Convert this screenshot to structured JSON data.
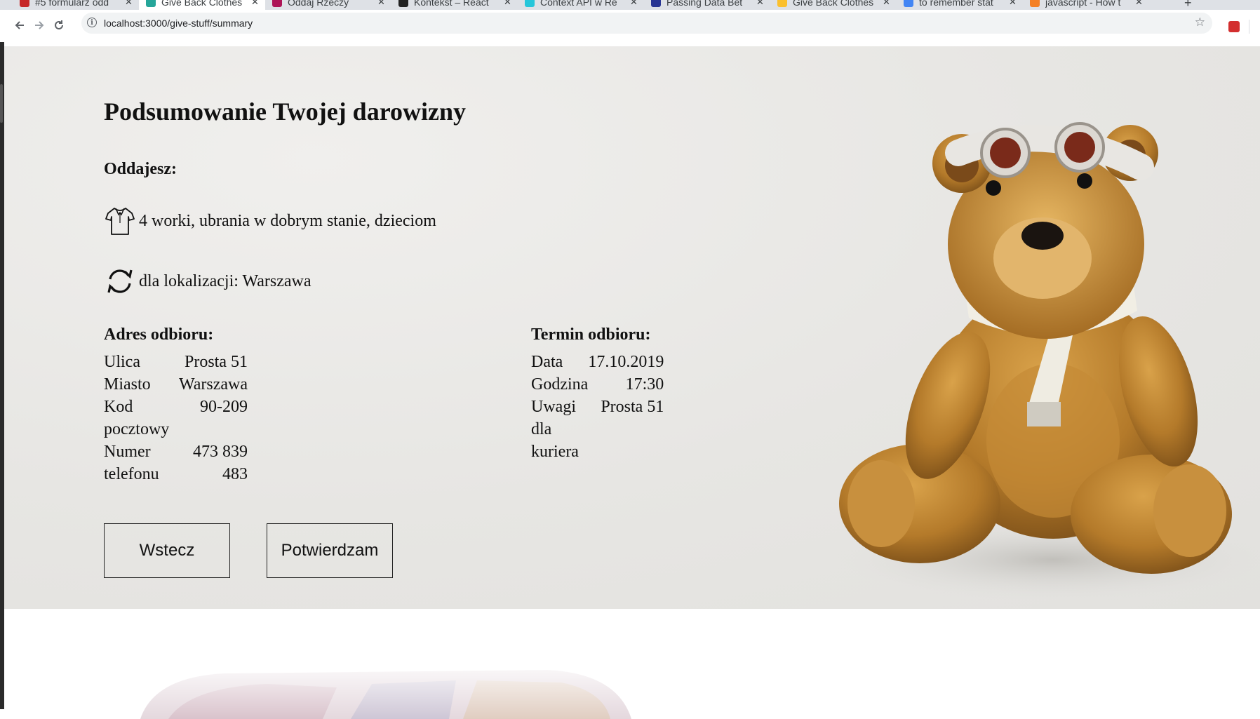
{
  "browser": {
    "tabs": [
      {
        "title": "#5 formularz odd",
        "color": "#e8e8e8",
        "fav": "#c62828",
        "active": false
      },
      {
        "title": "Give Back Clothes",
        "color": "#ffffff",
        "fav": "#26a69a",
        "active": true
      },
      {
        "title": "Oddaj Rzeczy",
        "color": "#e8e8e8",
        "fav": "#ad1457",
        "active": false
      },
      {
        "title": "Kontekst – React",
        "color": "#e8e8e8",
        "fav": "#222222",
        "active": false
      },
      {
        "title": "Context API w Re",
        "color": "#e8e8e8",
        "fav": "#26c6da",
        "active": false
      },
      {
        "title": "Passing Data Bet",
        "color": "#e8e8e8",
        "fav": "#283593",
        "active": false
      },
      {
        "title": "Give Back Clothes",
        "color": "#e8e8e8",
        "fav": "#fbc02d",
        "active": false
      },
      {
        "title": "to remember stat",
        "color": "#e8e8e8",
        "fav": "#4285f4",
        "active": false
      },
      {
        "title": "javascript - How t",
        "color": "#e8e8e8",
        "fav": "#f48024",
        "active": false
      }
    ],
    "new_tab_glyph": "+",
    "close_glyph": "✕",
    "minimize_glyph": "–",
    "url": "localhost:3000/give-stuff/summary"
  },
  "summary": {
    "title": "Podsumowanie Twojej darowizny",
    "giving_label": "Oddajesz:",
    "items_text": "4 worki, ubrania w dobrym stanie, dzieciom",
    "location_text": "dla lokalizacji: Warszawa",
    "address": {
      "heading": "Adres odbioru:",
      "street_label": "Ulica",
      "street": "Prosta 51",
      "city_label": "Miasto",
      "city": "Warszawa",
      "postcode_label": "Kod pocztowy",
      "postcode": "90-209",
      "phone_label": "Numer telefonu",
      "phone": "473 839 483"
    },
    "pickup": {
      "heading": "Termin odbioru:",
      "date_label": "Data",
      "date": "17.10.2019",
      "time_label": "Godzina",
      "time": "17:30",
      "notes_label": "Uwagi dla kuriera",
      "notes": "Prosta 51"
    },
    "back_button": "Wstecz",
    "confirm_button": "Potwierdzam"
  },
  "icons": [
    "back-arrow-icon",
    "forward-arrow-icon",
    "reload-icon",
    "info-icon",
    "star-icon",
    "tshirt-icon",
    "recycle-icon"
  ],
  "colors": {
    "hero_bg": "#e7e6e3",
    "text": "#111111",
    "button_border": "#222222"
  }
}
